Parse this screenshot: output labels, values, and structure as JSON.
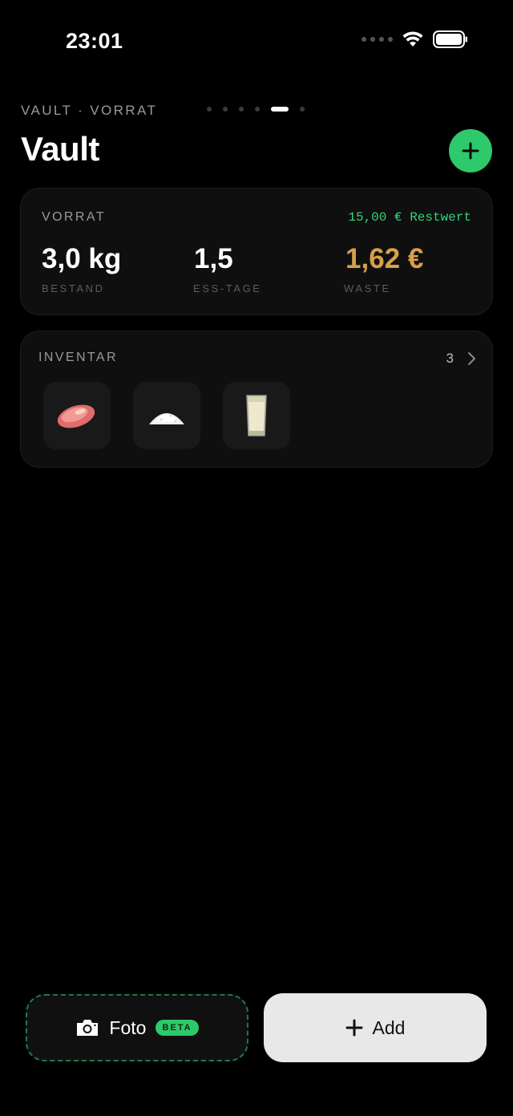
{
  "status_bar": {
    "time": "23:01",
    "icons": [
      "signal-dots-icon",
      "wifi-icon",
      "battery-icon"
    ]
  },
  "header": {
    "breadcrumb": "VAULT · VORRAT",
    "page_indicator": {
      "count": 6,
      "active_index": 4
    },
    "title": "Vault",
    "add_button_icon": "plus-icon"
  },
  "stock_card": {
    "label": "VORRAT",
    "restwert": "15,00 € Restwert",
    "metrics": [
      {
        "value": "3,0 kg",
        "label": "BESTAND"
      },
      {
        "value": "1,5",
        "label": "ESS-TAGE"
      },
      {
        "value": "1,62 €",
        "label": "WASTE"
      }
    ]
  },
  "inventory_card": {
    "label": "INVENTAR",
    "count": "3",
    "items": [
      {
        "icon": "meat-icon"
      },
      {
        "icon": "rice-icon"
      },
      {
        "icon": "milk-glass-icon"
      }
    ]
  },
  "bottom_actions": {
    "foto": {
      "label": "Foto",
      "badge": "BETA",
      "icon": "camera-icon"
    },
    "add": {
      "label": "Add",
      "icon": "plus-icon"
    }
  },
  "colors": {
    "accent_green": "#2ec96a",
    "waste_amber": "#d6a04a",
    "background": "#000000"
  }
}
